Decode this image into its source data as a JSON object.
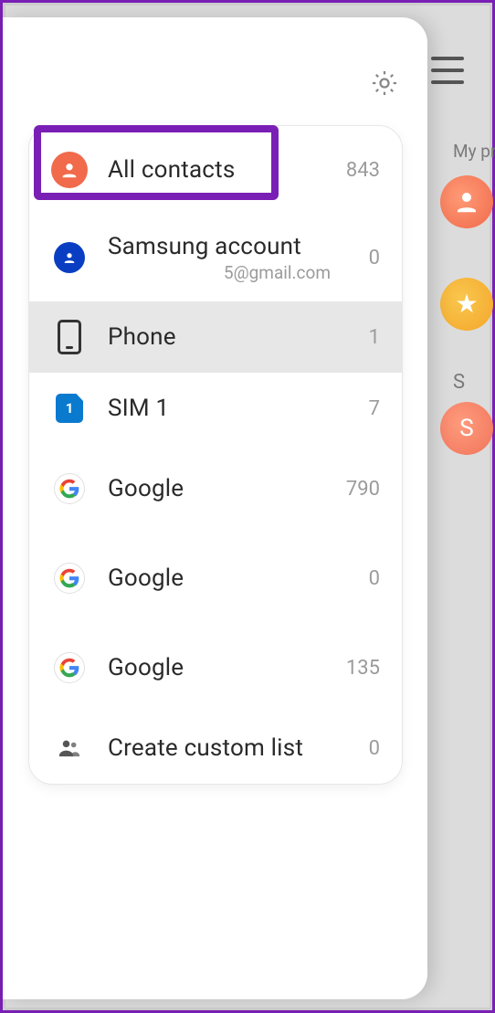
{
  "background": {
    "section_label": "My pr",
    "letter_header": "S",
    "avatar_letter": "S"
  },
  "drawer": {
    "items": [
      {
        "key": "all-contacts",
        "label": "All contacts",
        "sub": "",
        "count": "843"
      },
      {
        "key": "samsung",
        "label": "Samsung account",
        "sub": "5@gmail.com",
        "count": "0"
      },
      {
        "key": "phone",
        "label": "Phone",
        "sub": "",
        "count": "1"
      },
      {
        "key": "sim1",
        "label": "SIM 1",
        "sub": "",
        "count": "7"
      },
      {
        "key": "google-0",
        "label": "Google",
        "sub": "",
        "count": "790"
      },
      {
        "key": "google-1",
        "label": "Google",
        "sub": "",
        "count": "0"
      },
      {
        "key": "google-2",
        "label": "Google",
        "sub": "",
        "count": "135"
      },
      {
        "key": "create-list",
        "label": "Create custom list",
        "sub": "",
        "count": "0"
      }
    ],
    "sim_number": "1",
    "selected_key": "phone",
    "highlighted_key": "all-contacts"
  }
}
